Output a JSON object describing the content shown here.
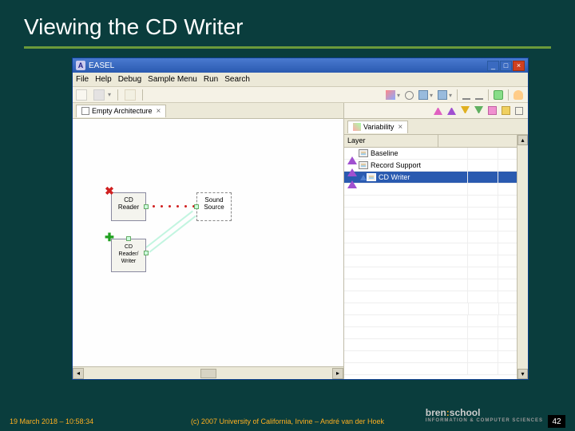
{
  "slide": {
    "title": "Viewing the CD Writer"
  },
  "window": {
    "title": "EASEL",
    "min": "_",
    "max": "□",
    "close": "×"
  },
  "menubar": {
    "file": "File",
    "help": "Help",
    "debug": "Debug",
    "sample": "Sample Menu",
    "run": "Run",
    "search": "Search"
  },
  "canvas": {
    "tab_label": "Empty Architecture",
    "tab_close": "×"
  },
  "components": {
    "cd_reader": "CD\nReader",
    "sound_source": "Sound\nSource",
    "cd_rw": "CD\nReader/\nWriter"
  },
  "variability": {
    "tab_label": "Variability",
    "tab_close": "×",
    "header_col1": "Layer",
    "rows": {
      "baseline": "Baseline",
      "record_support": "Record Support",
      "cd_writer": "CD Writer"
    }
  },
  "footer": {
    "date": "19 March 2018 – 10:58:34",
    "copy": "(c) 2007 University of California, Irvine – André van der Hoek",
    "page": "42",
    "logo_main": "bren",
    "logo_colon": ":",
    "logo_school": "school"
  }
}
